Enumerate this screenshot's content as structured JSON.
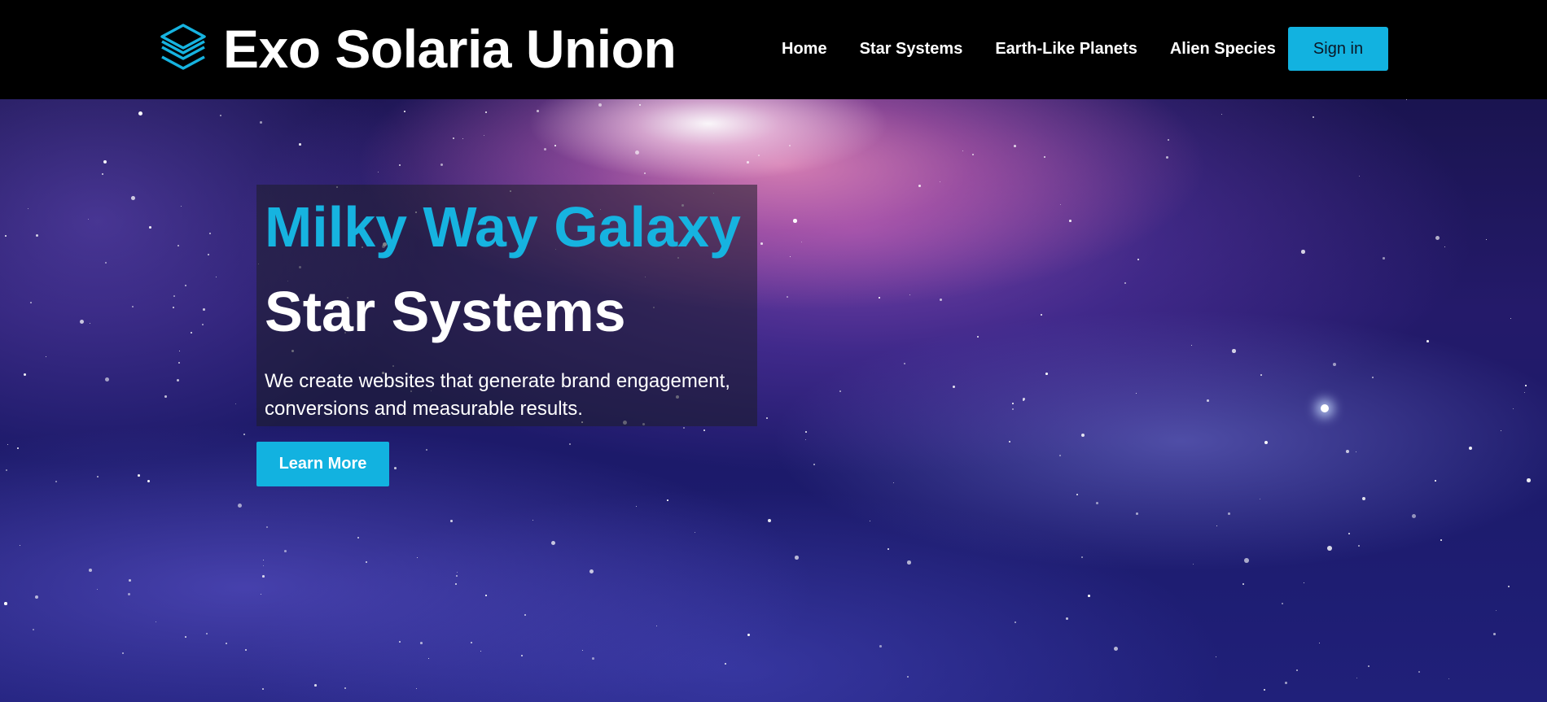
{
  "header": {
    "brand_name": "Exo Solaria Union",
    "brand_icon": "layers-icon",
    "nav": [
      {
        "label": "Home"
      },
      {
        "label": "Star Systems"
      },
      {
        "label": "Earth-Like Planets"
      },
      {
        "label": "Alien Species"
      }
    ],
    "signin_label": "Sign in"
  },
  "hero": {
    "kicker": "Milky Way Galaxy",
    "title": "Star Systems",
    "description": "We create websites that generate brand engagement, conversions and measurable results.",
    "cta_label": "Learn More"
  },
  "colors": {
    "accent": "#12b2e0",
    "header_bg": "#000000",
    "text": "#ffffff"
  }
}
